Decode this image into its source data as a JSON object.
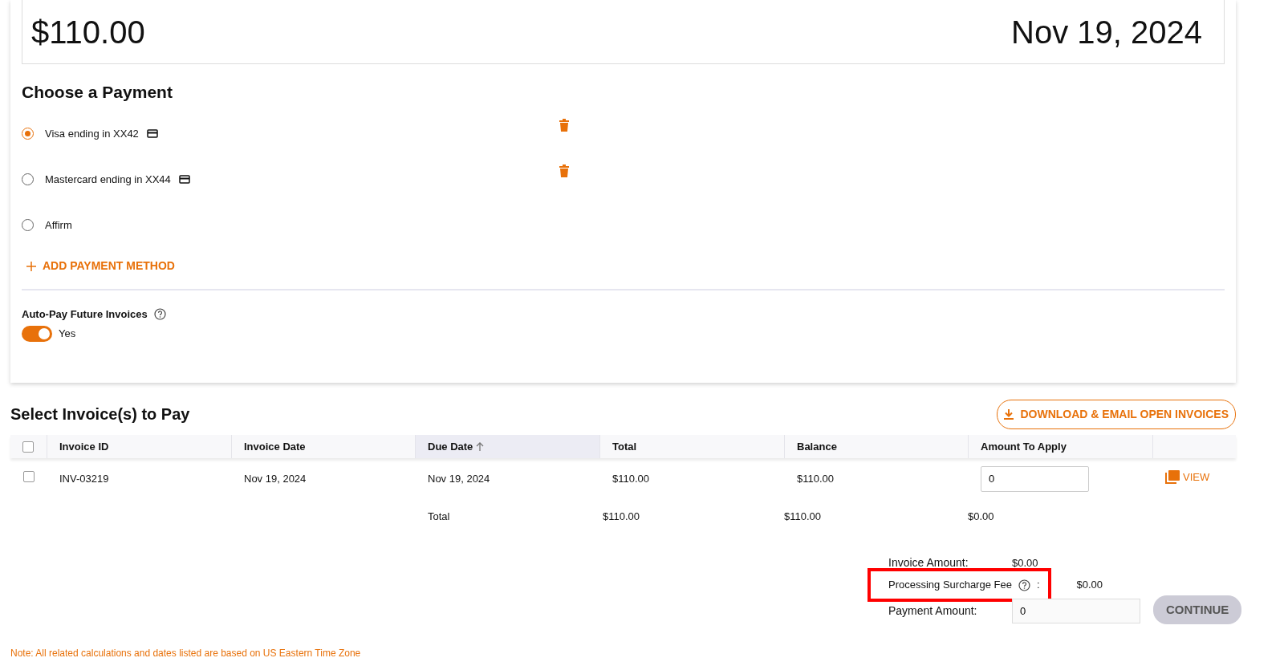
{
  "summary_card": {
    "amount": "$110.00",
    "date": "Nov 19, 2024"
  },
  "payment": {
    "heading": "Choose a Payment",
    "methods": [
      {
        "label": "Visa ending in XX42",
        "kind": "card",
        "selected": true,
        "deletable": true
      },
      {
        "label": "Mastercard ending in XX44",
        "kind": "card",
        "selected": false,
        "deletable": true
      },
      {
        "label": "Affirm",
        "kind": "plain",
        "selected": false,
        "deletable": false
      }
    ],
    "add_button": "ADD PAYMENT METHOD"
  },
  "autopay": {
    "label": "Auto-Pay Future Invoices",
    "on": true,
    "value": "Yes"
  },
  "invoices": {
    "heading": "Select Invoice(s) to Pay",
    "download_button": "DOWNLOAD & EMAIL OPEN INVOICES",
    "columns": [
      {
        "label": "Invoice ID",
        "sorted": false
      },
      {
        "label": "Invoice Date",
        "sorted": false
      },
      {
        "label": "Due Date",
        "sorted": true
      },
      {
        "label": "Total",
        "sorted": false
      },
      {
        "label": "Balance",
        "sorted": false
      },
      {
        "label": "Amount To Apply",
        "sorted": false
      }
    ],
    "all_checked": false,
    "rows": [
      {
        "checked": false,
        "invoice_id": "INV-03219",
        "invoice_date": "Nov 19, 2024",
        "due_date": "Nov 19, 2024",
        "total": "$110.00",
        "balance": "$110.00",
        "amount_to_apply": "0",
        "view": "VIEW"
      }
    ],
    "totals": {
      "label": "Total",
      "total": "$110.00",
      "balance": "$110.00",
      "amount": "$0.00"
    }
  },
  "payment_summary": {
    "invoice_amount_label": "Invoice Amount:",
    "invoice_amount": "$0.00",
    "surcharge_label": "Processing Surcharge Fee",
    "surcharge_colon": ":",
    "surcharge": "$0.00",
    "surcharge_highlighted": true,
    "payment_amount_label": "Payment Amount:",
    "payment_amount": "0",
    "continue_button": "CONTINUE",
    "continue_disabled": true
  },
  "note": "Note: All related calculations and dates listed are based on US Eastern Time Zone"
}
